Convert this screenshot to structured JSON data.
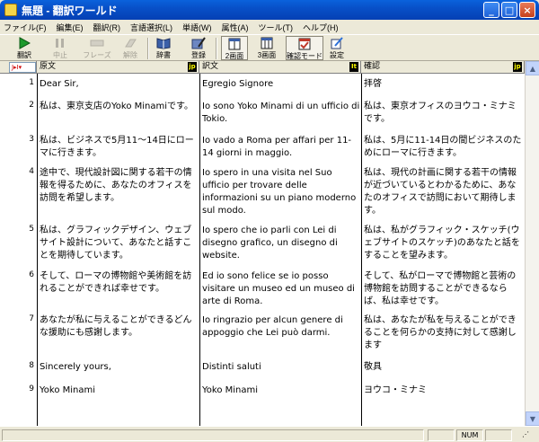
{
  "window": {
    "title": "無題 - 翻訳ワールド"
  },
  "menu": [
    "ファイル(F)",
    "編集(E)",
    "翻訳(R)",
    "言語選択(L)",
    "単語(W)",
    "属性(A)",
    "ツール(T)",
    "ヘルプ(H)"
  ],
  "toolbar": {
    "translate": "翻訳",
    "stop": "中止",
    "phrase": "フレーズ",
    "release": "解除",
    "dictionary": "辞書",
    "register": "登録",
    "two_pane": "2画面",
    "three_pane": "3画面",
    "review_mode": "確認モード",
    "settings": "設定"
  },
  "lang_selector": "J▸I▾",
  "columns": {
    "source": "原文",
    "target": "訳文",
    "review": "確認",
    "source_badge": "jp",
    "target_badge": "It",
    "review_badge": "jp"
  },
  "rows": [
    {
      "n": "1",
      "src": "Dear Sir,",
      "tgt": "Egregio Signore",
      "rev": "拝啓"
    },
    {
      "n": "2",
      "src": "私は、東京支店のYoko Minamiです。",
      "tgt": "Io sono Yoko Minami di un ufficio di Tokio.",
      "rev": "私は、東京オフィスのヨウコ・ミナミです。"
    },
    {
      "n": "3",
      "src": "私は、ビジネスで5月11～14日にローマに行きます。",
      "tgt": "Io vado a Roma per affari per 11-14 giorni in maggio.",
      "rev": "私は、5月に11-14日の間ビジネスのためにローマに行きます。"
    },
    {
      "n": "4",
      "src": "途中で、現代設計図に関する若干の情報を得るために、あなたのオフィスを訪問を希望します。",
      "tgt": "Io spero in una visita nel Suo ufficio per trovare delle informazioni su un piano moderno sul modo.",
      "rev": "私は、現代の計画に関する若干の情報が近づいているとわかるために、あなたのオフィスで訪問において期待します。"
    },
    {
      "n": "5",
      "src": "私は、グラフィックデザイン、ウェブサイト設計について、あなたと話すことを期待しています。",
      "tgt": "Io spero che io parli con Lei di disegno grafico, un disegno di website.",
      "rev": "私は、私がグラフィック・スケッチ(ウェブサイトのスケッチ)のあなたと話をすることを望みます。"
    },
    {
      "n": "6",
      "src": "そして、ローマの博物館や美術館を訪れることができれば幸せです。",
      "tgt": "Ed io sono felice se io posso visitare un museo ed un museo di arte di Roma.",
      "rev": "そして、私がローマで博物館と芸術の博物館を訪問することができるならば、私は幸せです。"
    },
    {
      "n": "7",
      "src": "あなたが私に与えることができるどんな援助にも感謝します。",
      "tgt": "Io ringrazio per alcun genere di appoggio che Lei può darmi.",
      "rev": "私は、あなたが私を与えることができることを何らかの支持に対して感謝します"
    },
    {
      "n": "8",
      "src": "Sincerely yours,",
      "tgt": "Distinti saluti",
      "rev": "敬具"
    },
    {
      "n": "9",
      "src": "Yoko Minami",
      "tgt": "Yoko Minami",
      "rev": "ヨウコ・ミナミ"
    }
  ],
  "status": {
    "num": "NUM"
  }
}
